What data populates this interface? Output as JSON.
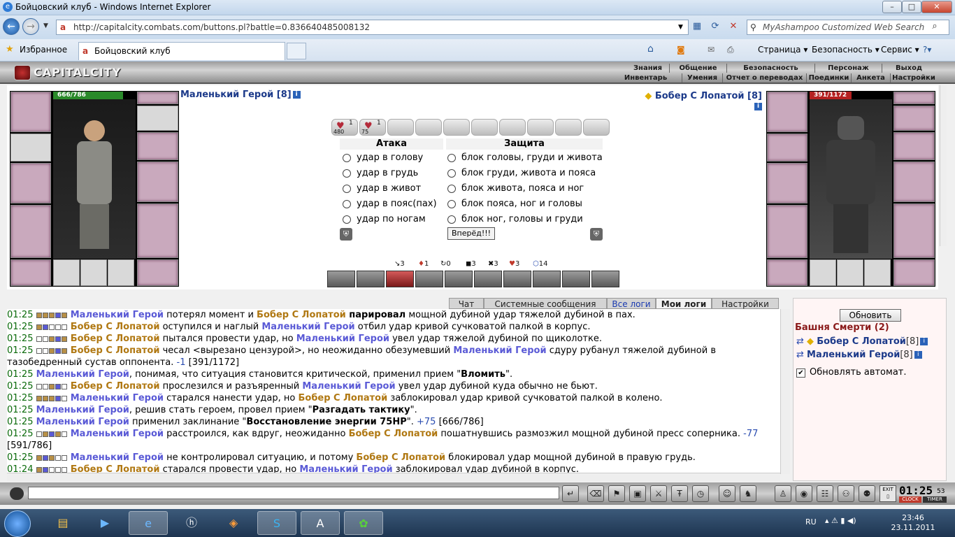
{
  "window": {
    "title": "Бойцовский клуб - Windows Internet Explorer",
    "min": "–",
    "max": "□",
    "close": "✕"
  },
  "browser": {
    "url": "http://capitalcity.combats.com/buttons.pl?battle=0.836640485008132",
    "search_placeholder": "MyAshampoo Customized Web Search",
    "favorites": "Избранное",
    "tab_title": "Бойцовский клуб",
    "commands": [
      "Страница ▾",
      "Безопасность ▾",
      "Сервис ▾"
    ]
  },
  "game_header": {
    "logo": "CAPITALCITY",
    "menu": [
      "Знания",
      "Общение",
      "Безопасность",
      "Персонаж",
      "Выход"
    ],
    "submenu": [
      "Инвентарь",
      "Умения",
      "Отчет о переводах",
      "Поединки",
      "Анкета",
      "Настройки"
    ]
  },
  "player": {
    "name": "Маленький Герой [8]",
    "hp": "666/786",
    "hp_fraction": 0.847
  },
  "enemy": {
    "name": "Бобер С Лопатой [8]",
    "hp": "391/1172",
    "hp_fraction": 0.334
  },
  "scrolls": [
    {
      "num": "1",
      "count": "480"
    },
    {
      "num": "1",
      "count": "75"
    }
  ],
  "combat": {
    "attack_header": "Атака",
    "defense_header": "Защита",
    "attacks": [
      "удар в голову",
      "удар в грудь",
      "удар в живот",
      "удар в пояс(пах)",
      "удар по ногам"
    ],
    "defenses": [
      "блок головы, груди и живота",
      "блок груди, живота и пояса",
      "блок живота, пояса и ног",
      "блок пояса, ног и головы",
      "блок ног, головы и груди"
    ],
    "go_button": "Вперёд!!!"
  },
  "tactics": [
    {
      "icon": "↘",
      "value": "3"
    },
    {
      "icon": "♦",
      "value": "1"
    },
    {
      "icon": "↻",
      "value": "0"
    },
    {
      "icon": "◼",
      "value": "3"
    },
    {
      "icon": "✖",
      "value": "3"
    },
    {
      "icon": "♥",
      "value": "3"
    },
    {
      "icon": "⬡",
      "value": "14"
    }
  ],
  "chat_tabs": [
    "Чат",
    "Системные сообщения",
    "Все логи",
    "Мои логи",
    "Настройки"
  ],
  "log": [
    {
      "time": "01:25",
      "sq": "fffdf",
      "parts": [
        [
          "p1",
          "Маленький Герой"
        ],
        [
          "n",
          " потерял момент и "
        ],
        [
          "p2",
          "Бобер С Лопатой"
        ],
        [
          "b",
          " парировал"
        ],
        [
          "n",
          " мощной дубиной удар тяжелой дубиной в пах."
        ]
      ]
    },
    {
      "time": "01:25",
      "sq": "fdnnn",
      "parts": [
        [
          "p2",
          "Бобер С Лопатой"
        ],
        [
          "n",
          " оступился и наглый "
        ],
        [
          "p1",
          "Маленький Герой"
        ],
        [
          "n",
          " отбил удар кривой сучковатой палкой в корпус."
        ]
      ]
    },
    {
      "time": "01:25",
      "sq": "nnfdf",
      "parts": [
        [
          "p2",
          "Бобер С Лопатой"
        ],
        [
          "n",
          " пытался провести удар, но "
        ],
        [
          "p1",
          "Маленький Герой"
        ],
        [
          "n",
          " увел удар тяжелой дубиной по щиколотке."
        ]
      ]
    },
    {
      "time": "01:25",
      "sq": "nnfdf",
      "parts": [
        [
          "p2",
          "Бобер С Лопатой"
        ],
        [
          "n",
          " чесал <вырезано цензурой>, но неожиданно обезумевший "
        ],
        [
          "p1",
          "Маленький Герой"
        ],
        [
          "n",
          " сдуру рубанул тяжелой дубиной в"
        ]
      ]
    },
    {
      "time": "",
      "sq": "",
      "parts": [
        [
          "n",
          "тазобедренный сустав оппонента. "
        ],
        [
          "dmg",
          "-1"
        ],
        [
          "n",
          " [391/1172]"
        ]
      ]
    },
    {
      "time": "01:25",
      "sq": "",
      "parts": [
        [
          "p1",
          "Маленький Герой"
        ],
        [
          "n",
          ", понимая, что ситуация становится критической, применил прием \""
        ],
        [
          "b",
          "Вломить"
        ],
        [
          "n",
          "\"."
        ]
      ]
    },
    {
      "time": "01:25",
      "sq": "nnfdn",
      "parts": [
        [
          "p2",
          "Бобер С Лопатой"
        ],
        [
          "n",
          " прослезился и разъяренный "
        ],
        [
          "p1",
          "Маленький Герой"
        ],
        [
          "n",
          " увел удар дубиной куда обычно не бьют."
        ]
      ]
    },
    {
      "time": "01:25",
      "sq": "fffdn",
      "parts": [
        [
          "p1",
          "Маленький Герой"
        ],
        [
          "n",
          " старался нанести удар, но "
        ],
        [
          "p2",
          "Бобер С Лопатой"
        ],
        [
          "n",
          " заблокировал удар кривой сучковатой палкой в колено."
        ]
      ]
    },
    {
      "time": "01:25",
      "sq": "",
      "parts": [
        [
          "p1",
          "Маленький Герой"
        ],
        [
          "n",
          ", решив стать героем, провел прием \""
        ],
        [
          "b",
          "Разгадать тактику"
        ],
        [
          "n",
          "\"."
        ]
      ]
    },
    {
      "time": "01:25",
      "sq": "",
      "parts": [
        [
          "p1",
          "Маленький Герой"
        ],
        [
          "n",
          " применил заклинание \""
        ],
        [
          "b",
          "Восстановление энергии 75HP"
        ],
        [
          "n",
          "\". "
        ],
        [
          "dmg",
          "+75"
        ],
        [
          "n",
          " [666/786]"
        ]
      ]
    },
    {
      "time": "01:25",
      "sq": "nfdfn",
      "parts": [
        [
          "p1",
          "Маленький Герой"
        ],
        [
          "n",
          " расстроился, как вдруг, неожиданно "
        ],
        [
          "p2",
          "Бобер С Лопатой"
        ],
        [
          "n",
          " пошатнувшись размозжил мощной дубиной пресс соперника. "
        ],
        [
          "dmg",
          "-77"
        ]
      ]
    },
    {
      "time": "",
      "sq": "",
      "parts": [
        [
          "n",
          "[591/786]"
        ]
      ]
    },
    {
      "time": "01:25",
      "sq": "fdfnn",
      "parts": [
        [
          "p1",
          "Маленький Герой"
        ],
        [
          "n",
          " не контролировал ситуацию, и потому "
        ],
        [
          "p2",
          "Бобер С Лопатой"
        ],
        [
          "n",
          " блокировал удар мощной дубиной в правую грудь."
        ]
      ]
    },
    {
      "time": "01:24",
      "sq": "fdnnn",
      "parts": [
        [
          "p2",
          "Бобер С Лопатой"
        ],
        [
          "n",
          " старался провести удар, но "
        ],
        [
          "p1",
          "Маленький Герой"
        ],
        [
          "n",
          " заблокировал удар дубиной в корпус."
        ]
      ]
    }
  ],
  "side": {
    "refresh": "Обновить",
    "tower": "Башня Смерти (2)",
    "fighters": [
      {
        "name": "Бобер С Лопатой",
        "lvl": "[8]"
      },
      {
        "name": "Маленький Герой",
        "lvl": "[8]"
      }
    ],
    "auto_refresh": "Обновлять автомат."
  },
  "timer": {
    "time": "01:25",
    "sec": "53",
    "clock_label": "CLOCK",
    "timer_label": "TIMER",
    "exit_label": "EXIT"
  },
  "taskbar": {
    "lang": "RU",
    "time": "23:46",
    "date": "23.11.2011"
  },
  "colors": {
    "ally": "#5a5ad6",
    "enemy": "#b07812",
    "timestamp": "#0a6a0a"
  }
}
